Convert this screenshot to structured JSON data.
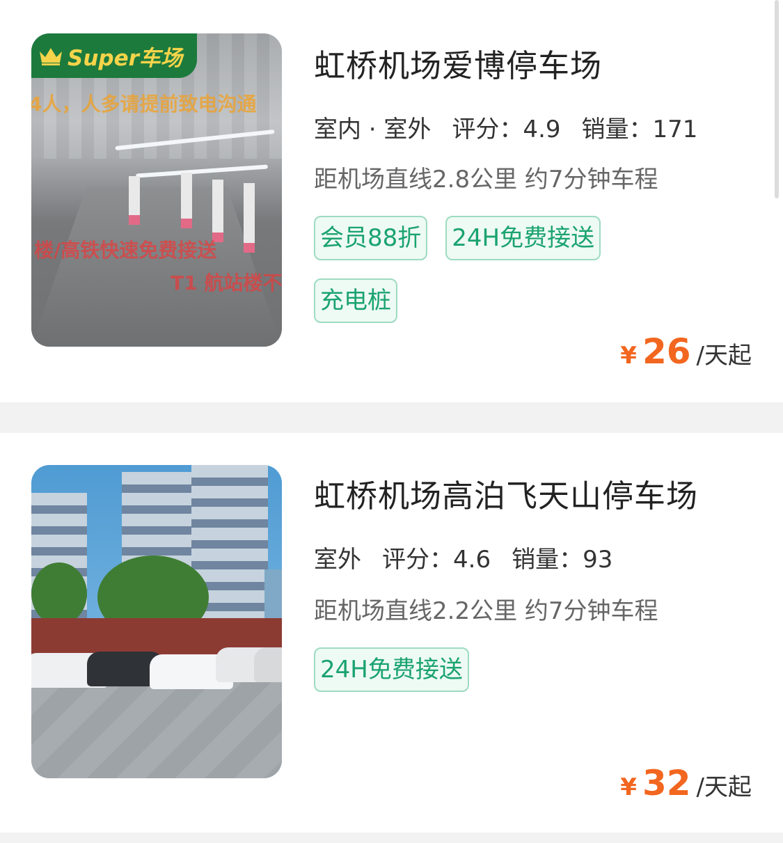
{
  "listings": [
    {
      "badge": "Super车场",
      "overlay_text": [
        "4人，人多请提前致电沟通",
        "楼/高铁快速免费接送",
        "T1 航站楼不"
      ],
      "name": "虹桥机场爱博停车场",
      "environment": "室内 · 室外",
      "rating_label": "评分：4.9",
      "sales_label": "销量：171",
      "distance": "距机场直线2.8公里 约7分钟车程",
      "tags": [
        "会员88折",
        "24H免费接送",
        "充电桩"
      ],
      "price": {
        "currency": "¥",
        "amount": "26",
        "unit": "/天起"
      }
    },
    {
      "name": "虹桥机场高泊飞天山停车场",
      "environment": "室外",
      "rating_label": "评分：4.6",
      "sales_label": "销量：93",
      "distance": "距机场直线2.2公里 约7分钟车程",
      "tags": [
        "24H免费接送"
      ],
      "price": {
        "currency": "¥",
        "amount": "32",
        "unit": "/天起"
      }
    }
  ],
  "colors": {
    "accent_green": "#1aa36f",
    "price_orange": "#f2661f",
    "badge_green": "#1d7a3d"
  }
}
